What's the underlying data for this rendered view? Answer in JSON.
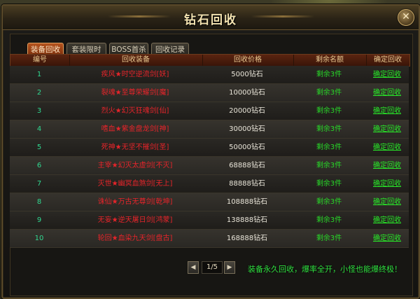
{
  "window": {
    "title": "钻石回收"
  },
  "tabs": [
    {
      "label": "装备回收",
      "active": true
    },
    {
      "label": "套装限时",
      "active": false
    },
    {
      "label": "BOSS首杀",
      "active": false
    },
    {
      "label": "回收记录",
      "active": false
    }
  ],
  "table": {
    "headers": [
      "编号",
      "回收装备",
      "回收价格",
      "剩余名额",
      "确定回收"
    ],
    "rows": [
      {
        "id": "1",
        "item": "疾风★时空逆流剑[妖]",
        "price": "5000钻石",
        "remaining": "剩余3件",
        "action": "确定回收"
      },
      {
        "id": "2",
        "item": "裂魂★至尊荣耀剑[魔]",
        "price": "10000钻石",
        "remaining": "剩余3件",
        "action": "确定回收"
      },
      {
        "id": "3",
        "item": "烈火★幻灭狂魂剑[仙]",
        "price": "20000钻石",
        "remaining": "剩余3件",
        "action": "确定回收"
      },
      {
        "id": "4",
        "item": "嗜血★紫金盘龙剑[神]",
        "price": "30000钻石",
        "remaining": "剩余3件",
        "action": "确定回收"
      },
      {
        "id": "5",
        "item": "死神★无坚不摧剑[圣]",
        "price": "50000钻石",
        "remaining": "剩余3件",
        "action": "确定回收"
      },
      {
        "id": "6",
        "item": "主宰★幻灭太虚剑[不灭]",
        "price": "68888钻石",
        "remaining": "剩余3件",
        "action": "确定回收"
      },
      {
        "id": "7",
        "item": "灭世★幽冥血煞剑[无上]",
        "price": "88888钻石",
        "remaining": "剩余3件",
        "action": "确定回收"
      },
      {
        "id": "8",
        "item": "诛仙★万古无尊剑[乾坤]",
        "price": "108888钻石",
        "remaining": "剩余3件",
        "action": "确定回收"
      },
      {
        "id": "9",
        "item": "无妄★逆天屠日剑[鸿蒙]",
        "price": "138888钻石",
        "remaining": "剩余3件",
        "action": "确定回收"
      },
      {
        "id": "10",
        "item": "轮回★血染九天剑[盘古]",
        "price": "168888钻石",
        "remaining": "剩余3件",
        "action": "确定回收"
      }
    ]
  },
  "pager": {
    "page_text": "1/5",
    "prev_icon": "triangle-left",
    "next_icon": "triangle-right"
  },
  "promo": "装备永久回收，爆率全开，小怪也能爆终极！",
  "icons": {
    "close": "close-icon"
  },
  "colors": {
    "item_name": "#e8242a",
    "remaining": "#28d828",
    "action_link": "#28e828",
    "index": "#30d890",
    "tab_active": "#b4531e"
  }
}
